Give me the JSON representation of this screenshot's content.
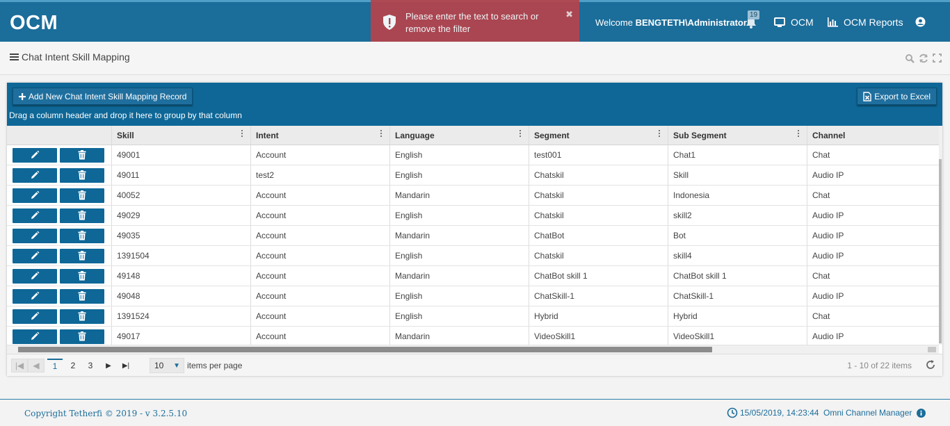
{
  "app": {
    "logo": "OCM",
    "welcome_prefix": "Welcome ",
    "welcome_user": "BENGTETH\\Administrator",
    "notification_count": "19",
    "nav_ocm": "OCM",
    "nav_reports": "OCM Reports"
  },
  "toast": {
    "message": "Please enter the text to search or remove the filter",
    "close": "✖"
  },
  "page": {
    "title": "Chat Intent Skill Mapping"
  },
  "toolbar": {
    "add_label": "Add New Chat Intent Skill Mapping Record",
    "export_label": "Export to Excel",
    "group_hint": "Drag a column header and drop it here to group by that column"
  },
  "grid": {
    "columns": [
      "",
      "Skill",
      "Intent",
      "Language",
      "Segment",
      "Sub Segment",
      "Channel"
    ],
    "rows": [
      [
        "49001",
        "Account",
        "English",
        "test001",
        "Chat1",
        "Chat"
      ],
      [
        "49011",
        "test2",
        "English",
        "Chatskil",
        "Skill",
        "Audio IP"
      ],
      [
        "40052",
        "Account",
        "Mandarin",
        "Chatskil",
        "Indonesia",
        "Chat"
      ],
      [
        "49029",
        "Account",
        "English",
        "Chatskil",
        "skill2",
        "Audio IP"
      ],
      [
        "49035",
        "Account",
        "Mandarin",
        "ChatBot",
        "Bot",
        "Audio IP"
      ],
      [
        "1391504",
        "Account",
        "English",
        "Chatskil",
        "skill4",
        "Audio IP"
      ],
      [
        "49148",
        "Account",
        "Mandarin",
        "ChatBot skill 1",
        "ChatBot skill 1",
        "Chat"
      ],
      [
        "49048",
        "Account",
        "English",
        "ChatSkill-1",
        "ChatSkill-1",
        "Audio IP"
      ],
      [
        "1391524",
        "Account",
        "English",
        "Hybrid",
        "Hybrid",
        "Chat"
      ],
      [
        "49017",
        "Account",
        "Mandarin",
        "VideoSkill1",
        "VideoSkill1",
        "Audio IP"
      ]
    ]
  },
  "pager": {
    "pages": [
      "1",
      "2",
      "3"
    ],
    "current": "1",
    "page_size": "10",
    "items_per_page_label": "items per page",
    "info": "1 - 10 of 22 items"
  },
  "footer": {
    "copyright": "Copyright Tetherfi © 2019 - v 3.2.5.10",
    "datetime": "15/05/2019, 14:23:44",
    "app_name": "Omni Channel Manager"
  },
  "colors": {
    "header": "#1b6d9a",
    "toolbar": "#0e6797",
    "toast": "#b5444c"
  }
}
